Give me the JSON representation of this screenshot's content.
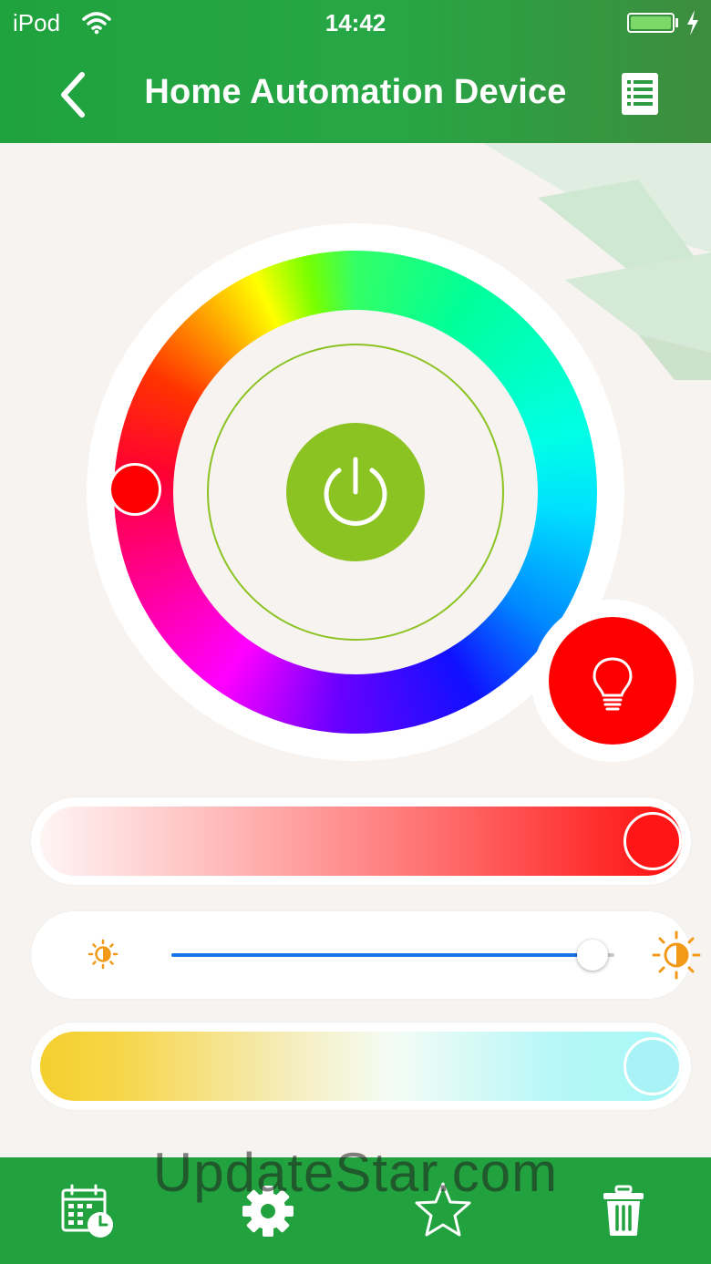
{
  "status_bar": {
    "carrier": "iPod",
    "time": "14:42"
  },
  "nav_bar": {
    "title": "Home Automation Device",
    "back_icon": "chevron-left-icon",
    "menu_icon": "list-icon"
  },
  "color_wheel": {
    "selected_color": "#ff0000",
    "center_icon": "power-icon",
    "center_color": "#8bc322"
  },
  "bulb_button": {
    "icon": "lightbulb-icon",
    "color": "#ff0000"
  },
  "saturation_slider": {
    "value_percent": 100,
    "color": "#ff0000"
  },
  "brightness_slider": {
    "value_percent": 95,
    "min_icon": "brightness-low-icon",
    "max_icon": "brightness-high-icon",
    "accent": "#1a73e8"
  },
  "temperature_slider": {
    "value_percent": 100,
    "warm_color": "#f5cf2e",
    "cool_color": "#a6f7f7"
  },
  "tab_bar": {
    "items": [
      {
        "name": "schedule",
        "icon": "calendar-clock-icon"
      },
      {
        "name": "settings",
        "icon": "gear-icon"
      },
      {
        "name": "favorite",
        "icon": "star-icon"
      },
      {
        "name": "delete",
        "icon": "trash-icon"
      }
    ],
    "background": "#22a23f"
  },
  "watermark": "UpdateStar.com"
}
